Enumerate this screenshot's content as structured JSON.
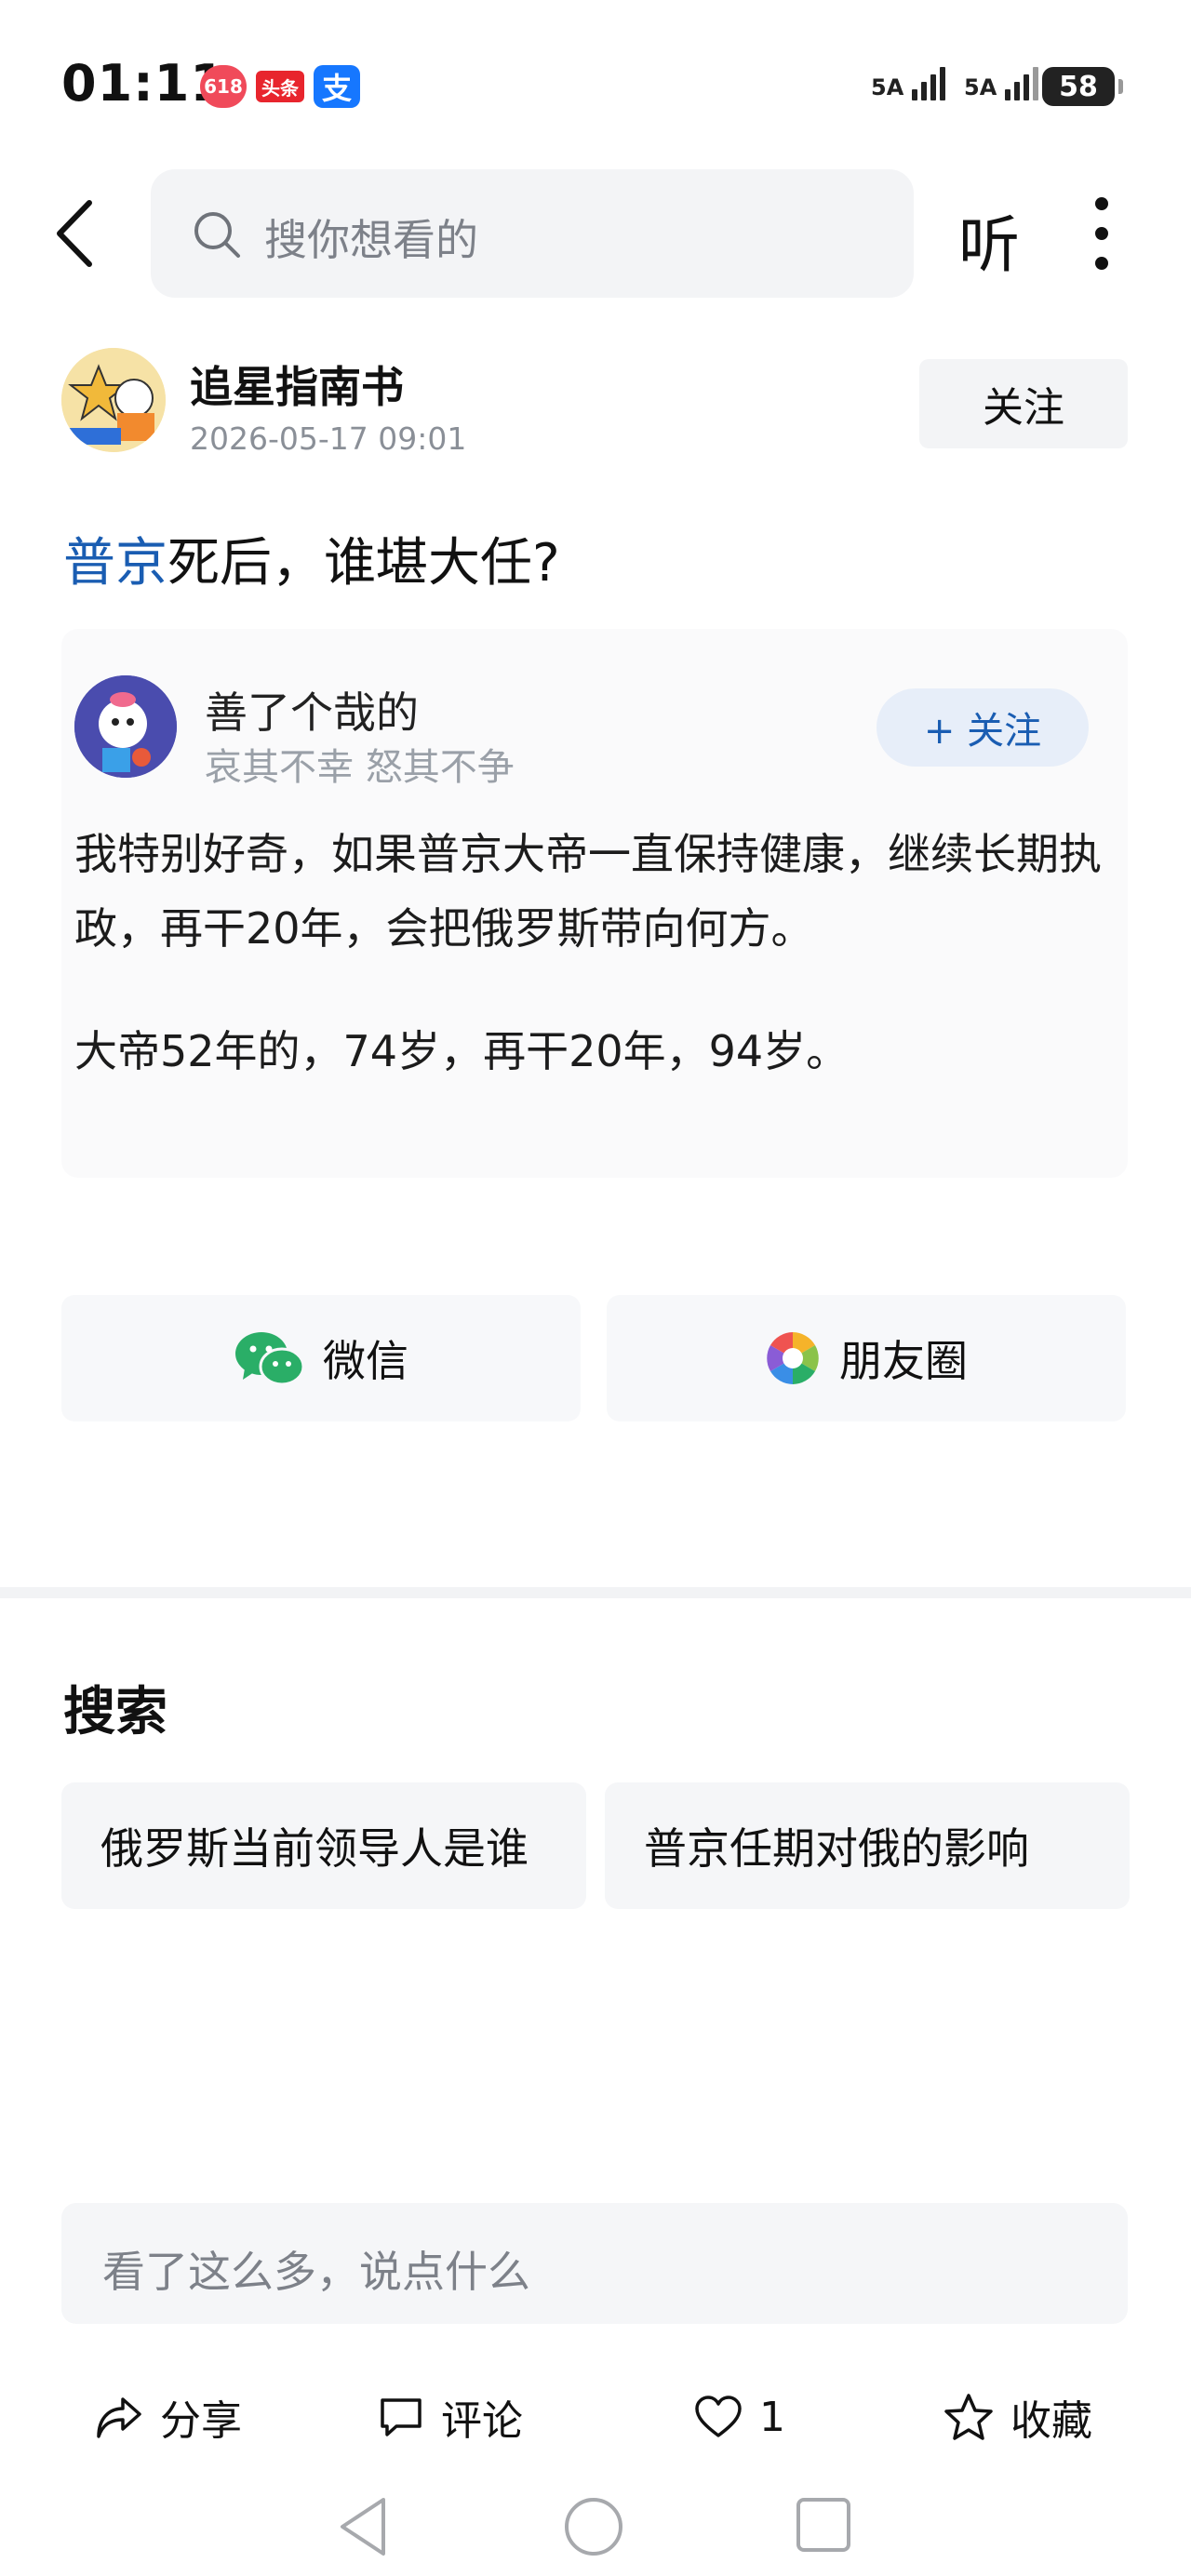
{
  "status_bar": {
    "time": "01:11",
    "app_badges": [
      "618",
      "头条",
      "支"
    ],
    "signal_1": "5A",
    "signal_2": "5A",
    "battery": "58"
  },
  "nav": {
    "search_placeholder": "搜你想看的",
    "listen_label": "听",
    "back_icon": "chevron-left-icon",
    "more_icon": "more-vertical-icon"
  },
  "author": {
    "name": "追星指南书",
    "date": "2026-05-17 09:01",
    "follow_label": "关注"
  },
  "article": {
    "title_link": "普京",
    "title_rest": "死后，谁堪大任?"
  },
  "quoted": {
    "user_name": "善了个哉的",
    "user_signature": "哀其不幸 怒其不争",
    "follow_label": "+ 关注",
    "paragraph_1": "我特别好奇，如果普京大帝一直保持健康，继续长期执政，再干20年，会把俄罗斯带向何方。",
    "paragraph_2": "大帝52年的，74岁，再干20年，94岁。"
  },
  "share": {
    "wechat_label": "微信",
    "moments_label": "朋友圈"
  },
  "search_section": {
    "title": "搜索",
    "suggestions": [
      "俄罗斯当前领导人是谁",
      "普京任期对俄的影响"
    ]
  },
  "comment_box": {
    "placeholder": "看了这么多，说点什么"
  },
  "actions": {
    "share_label": "分享",
    "comment_label": "评论",
    "like_count": "1",
    "favorite_label": "收藏"
  },
  "colors": {
    "accent_blue": "#1a5db2",
    "wechat_green": "#2aae67"
  }
}
